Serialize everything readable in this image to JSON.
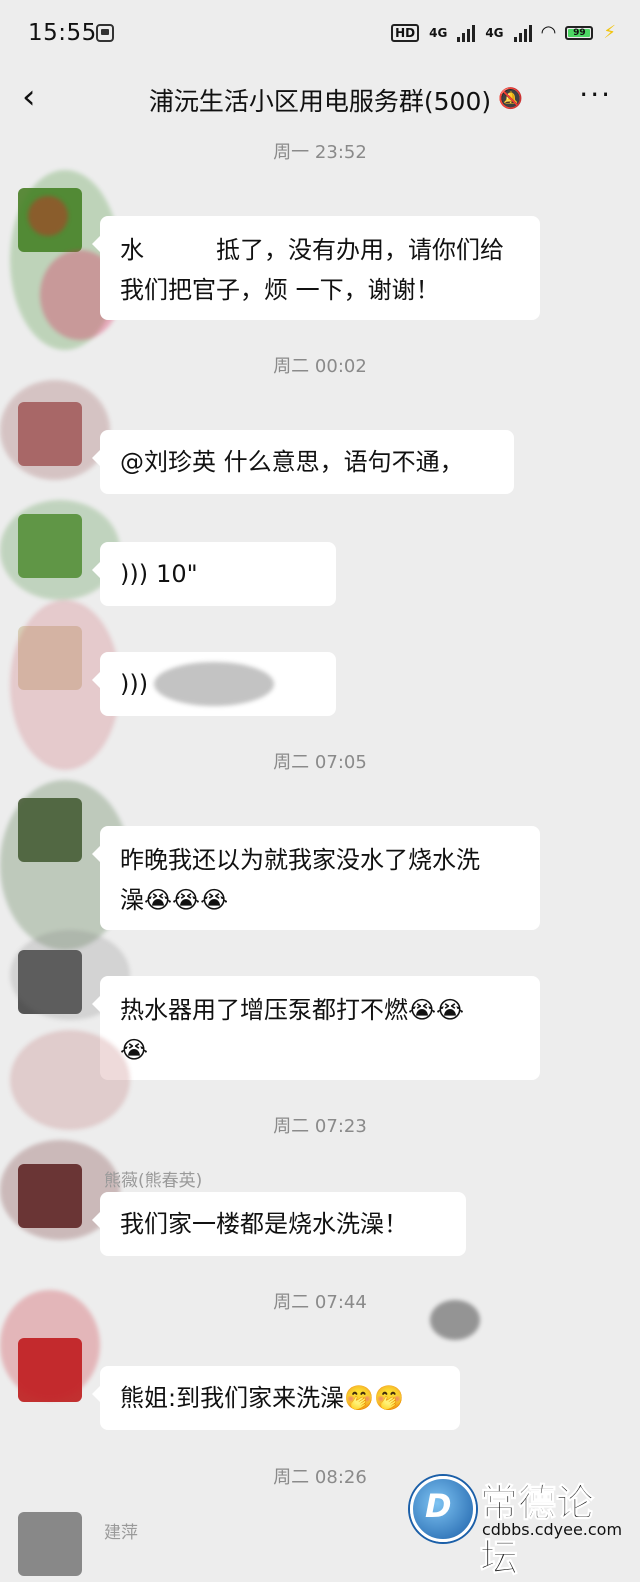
{
  "status_bar": {
    "time": "15:55",
    "hd_label": "HD",
    "network_1": "4G",
    "network_2": "4G",
    "battery_level": "99"
  },
  "header": {
    "title": "浦沅生活小区用电服务群(500)",
    "back_icon": "chevron-left-icon",
    "mute_icon": "bell-off-icon",
    "more_icon": "more-dots-icon"
  },
  "timestamps": [
    "周一 23:52",
    "周二 00:02",
    "周二 07:05",
    "周二 07:23",
    "周二 07:44",
    "周二 08:26"
  ],
  "messages": [
    {
      "sender": "",
      "text_line1": "水　　　抵了，没有办用，请你们给",
      "text_line2": "我们把官子，烦 一下，谢谢！"
    },
    {
      "sender": "",
      "text": "@刘珍英  什么意思，语句不通，"
    },
    {
      "sender": "",
      "voice_duration": "10\""
    },
    {
      "sender": "",
      "voice_duration": ""
    },
    {
      "sender": "",
      "text_line1": "昨晚我还以为就我家没水了烧水洗",
      "text_line2": "澡😭😭😭"
    },
    {
      "sender": "",
      "text_line1": "热水器用了增压泵都打不燃😭😭",
      "text_line2": "😭"
    },
    {
      "sender": "熊薇(熊春英)",
      "text": "我们家一楼都是烧水洗澡！"
    },
    {
      "sender": "",
      "text": "熊姐:到我们家来洗澡🤭🤭"
    },
    {
      "sender": "建萍"
    }
  ],
  "watermark": {
    "title": "常德论坛",
    "url": "cdbbs.cdyee.com"
  }
}
